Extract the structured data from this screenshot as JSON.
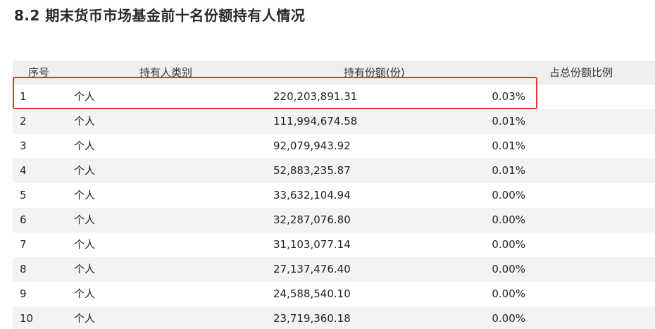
{
  "title": "8.2 期末货币市场基金前十名份额持有人情况",
  "table": {
    "headers": {
      "index": "序号",
      "holder_type": "持有人类别",
      "shares": "持有份额(份)",
      "ratio": "占总份额比例"
    },
    "rows": [
      {
        "index": "1",
        "holder_type": "个人",
        "shares": "220,203,891.31",
        "ratio": "0.03%"
      },
      {
        "index": "2",
        "holder_type": "个人",
        "shares": "111,994,674.58",
        "ratio": "0.01%"
      },
      {
        "index": "3",
        "holder_type": "个人",
        "shares": "92,079,943.92",
        "ratio": "0.01%"
      },
      {
        "index": "4",
        "holder_type": "个人",
        "shares": "52,883,235.87",
        "ratio": "0.01%"
      },
      {
        "index": "5",
        "holder_type": "个人",
        "shares": "33,632,104.94",
        "ratio": "0.00%"
      },
      {
        "index": "6",
        "holder_type": "个人",
        "shares": "32,287,076.80",
        "ratio": "0.00%"
      },
      {
        "index": "7",
        "holder_type": "个人",
        "shares": "31,103,077.14",
        "ratio": "0.00%"
      },
      {
        "index": "8",
        "holder_type": "个人",
        "shares": "27,137,476.40",
        "ratio": "0.00%"
      },
      {
        "index": "9",
        "holder_type": "个人",
        "shares": "24,588,540.10",
        "ratio": "0.00%"
      },
      {
        "index": "10",
        "holder_type": "个人",
        "shares": "23,719,360.18",
        "ratio": "0.00%"
      }
    ]
  },
  "colors": {
    "highlight": "#e8302c",
    "header_bg": "#efefef",
    "stripe_bg": "#f3f3f3"
  }
}
